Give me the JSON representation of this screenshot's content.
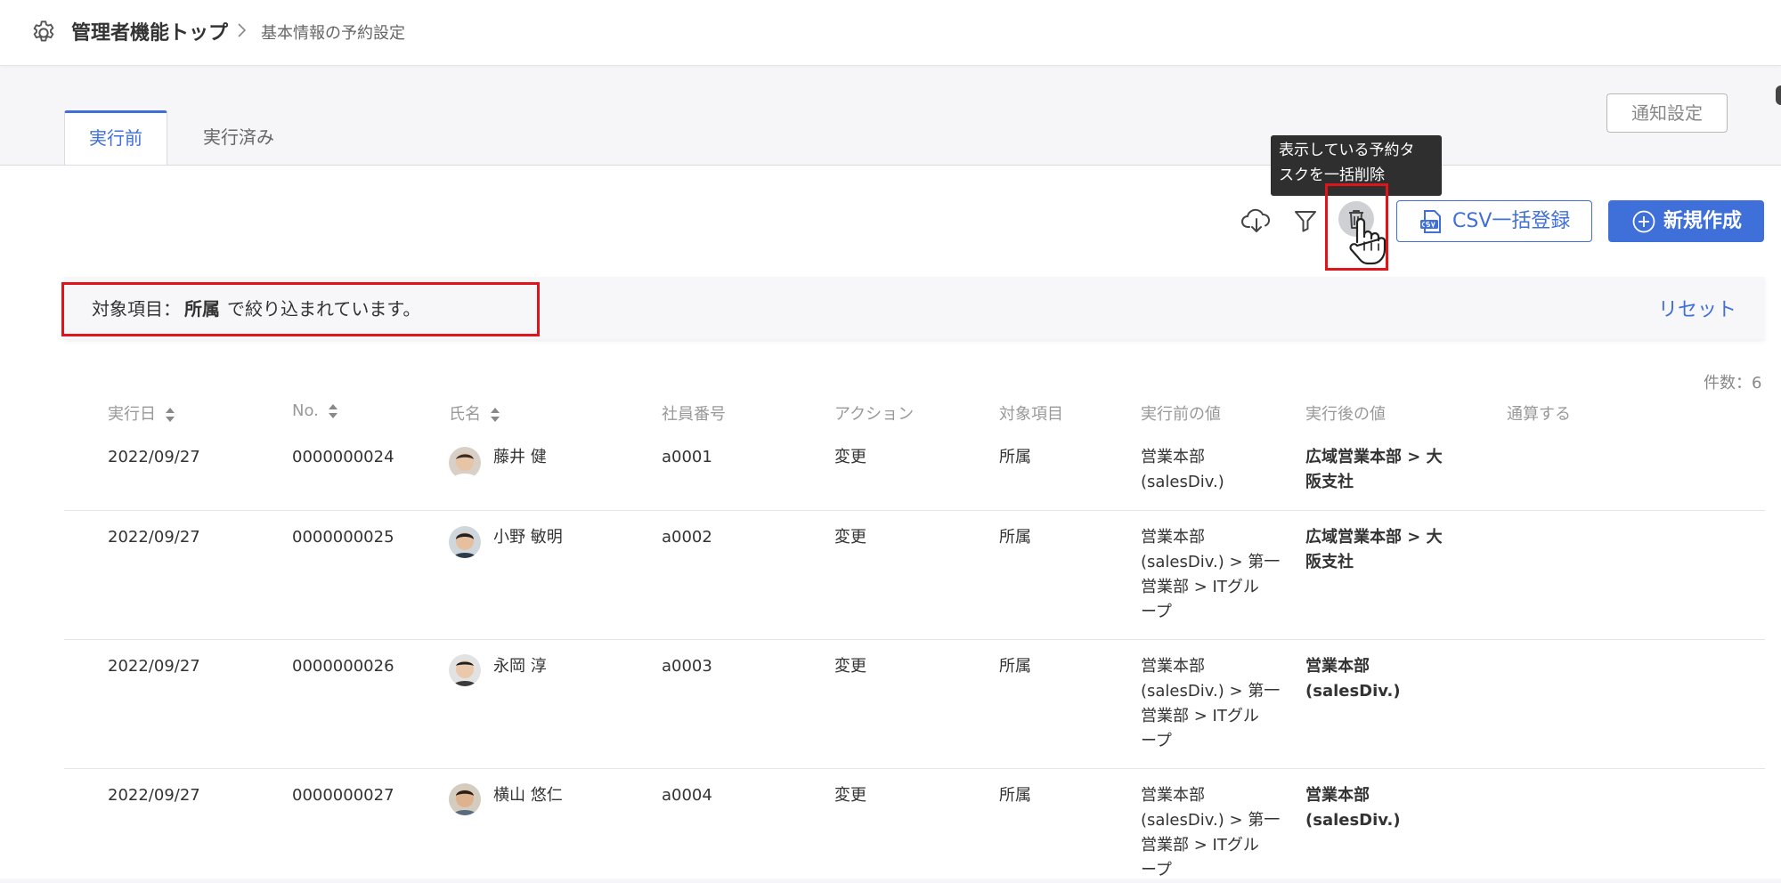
{
  "breadcrumb": {
    "main": "管理者機能トップ",
    "sub": "基本情報の予約設定"
  },
  "tabs": [
    {
      "label": "実行前"
    },
    {
      "label": "実行済み"
    }
  ],
  "notify_button": "通知設定",
  "tooltip": {
    "line1": "表示している予約タ",
    "line2": "スクを一括削除"
  },
  "toolbar": {
    "csv_label": "CSV一括登録",
    "new_label": "新規作成"
  },
  "filter": {
    "prefix": "対象項目：",
    "item": "所属",
    "suffix": "で絞り込まれています。",
    "reset": "リセット"
  },
  "count": "件数：6",
  "columns": [
    "実行日",
    "No.",
    "氏名",
    "社員番号",
    "アクション",
    "対象項目",
    "実行前の値",
    "実行後の値",
    "通算する"
  ],
  "rows": [
    {
      "date": "2022/09/27",
      "no": "0000000024",
      "name": "藤井 健",
      "emp": "a0001",
      "action": "変更",
      "target": "所属",
      "before": [
        "営業本部",
        "(salesDiv.)"
      ],
      "after": [
        "広域営業本部 > 大",
        "阪支社"
      ]
    },
    {
      "date": "2022/09/27",
      "no": "0000000025",
      "name": "小野 敏明",
      "emp": "a0002",
      "action": "変更",
      "target": "所属",
      "before": [
        "営業本部",
        "(salesDiv.) > 第一",
        "営業部 > ITグル",
        "ープ"
      ],
      "after": [
        "広域営業本部 > 大",
        "阪支社"
      ]
    },
    {
      "date": "2022/09/27",
      "no": "0000000026",
      "name": "永岡 淳",
      "emp": "a0003",
      "action": "変更",
      "target": "所属",
      "before": [
        "営業本部",
        "(salesDiv.) > 第一",
        "営業部 > ITグル",
        "ープ"
      ],
      "after": [
        "営業本部",
        "(salesDiv.)"
      ]
    },
    {
      "date": "2022/09/27",
      "no": "0000000027",
      "name": "横山 悠仁",
      "emp": "a0004",
      "action": "変更",
      "target": "所属",
      "before": [
        "営業本部",
        "(salesDiv.) > 第一",
        "営業部 > ITグル",
        "ープ"
      ],
      "after": [
        "営業本部",
        "(salesDiv.)"
      ]
    }
  ],
  "colors": {
    "accent": "#3f6fd8",
    "highlight": "#e0151b",
    "tooltip_bg": "#2f2f2f"
  },
  "icons": [
    "gear-icon",
    "chevron-right-icon",
    "cloud-download-icon",
    "filter-icon",
    "trash-icon",
    "hand-pointer-icon",
    "csv-icon",
    "plus-circle-icon",
    "sort-icon"
  ]
}
